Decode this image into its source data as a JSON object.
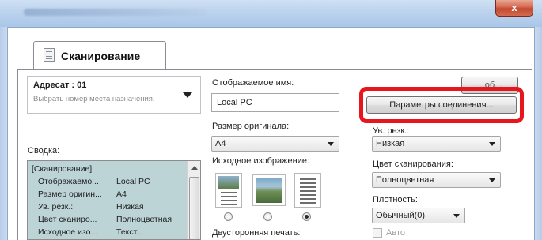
{
  "window": {
    "close_label": "x"
  },
  "tab": {
    "label": "Сканирование"
  },
  "destination": {
    "title": "Адресат : 01",
    "hint": "Выбрать номер места назначения."
  },
  "summary": {
    "label": "Сводка:",
    "rows": [
      {
        "key": "[Сканирование]",
        "value": ""
      },
      {
        "key": "Отображаемо...",
        "value": "Local PC"
      },
      {
        "key": "Размер оригин...",
        "value": "A4"
      },
      {
        "key": "Ув. резк.:",
        "value": "Низкая"
      },
      {
        "key": "Цвет сканиро...",
        "value": "Полноцветная"
      },
      {
        "key": "Исходное изо...",
        "value": "Текст..."
      }
    ]
  },
  "display_name": {
    "label": "Отображаемое имя:",
    "value": "Local PC"
  },
  "original_size": {
    "label": "Размер оригинала:",
    "value": "A4"
  },
  "original_image": {
    "label": "Исходное изображение:",
    "selected_index": 2
  },
  "duplex": {
    "label": "Двусторонняя печать:"
  },
  "buttons": {
    "top_partial": "...об...",
    "connection_params": "Параметры соединения..."
  },
  "sharpness": {
    "label": "Ув. резк.:",
    "value": "Низкая"
  },
  "scan_color": {
    "label": "Цвет сканирования:",
    "value": "Полноцветная"
  },
  "density": {
    "label": "Плотность:",
    "value": "Обычный(0)"
  },
  "auto": {
    "label": "Авто"
  },
  "colors": {
    "highlight": "#e8151b",
    "summary_bg": "#bcd4d6"
  }
}
